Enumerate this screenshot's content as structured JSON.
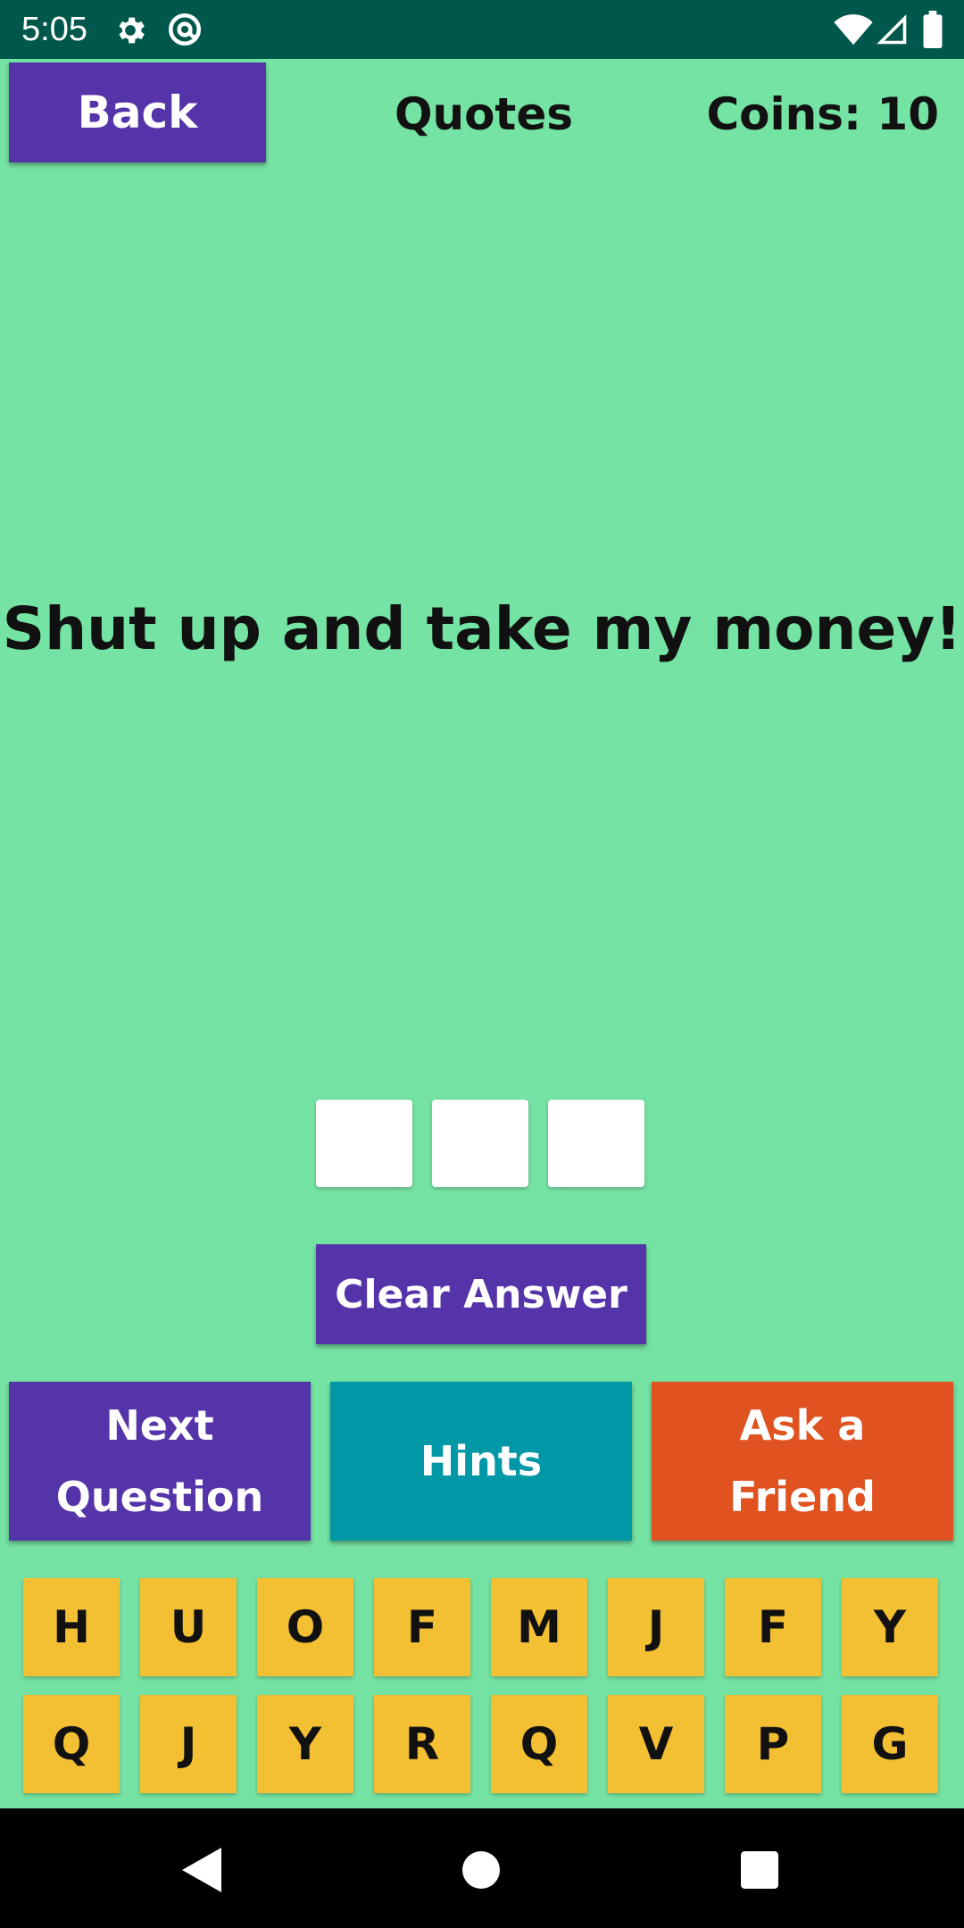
{
  "status_bar": {
    "time": "5:05",
    "icons": [
      "gear-icon",
      "at-sign-icon",
      "wifi-icon",
      "signal-icon",
      "battery-icon"
    ]
  },
  "header": {
    "back_label": "Back",
    "title": "Quotes",
    "coins": "Coins: 10"
  },
  "quote": "Shut up and take my money!",
  "answer_slots": [
    "",
    "",
    ""
  ],
  "clear_label": "Clear Answer",
  "actions": {
    "next_label": "Next\nQuestion",
    "hints_label": "Hints",
    "ask_label": "Ask a\nFriend"
  },
  "keys": {
    "row1": [
      "H",
      "U",
      "O",
      "F",
      "M",
      "J",
      "F",
      "Y"
    ],
    "row2": [
      "Q",
      "J",
      "Y",
      "R",
      "Q",
      "V",
      "P",
      "G"
    ]
  },
  "nav": {
    "icons": [
      "back-triangle-icon",
      "home-circle-icon",
      "recent-apps-square-icon"
    ]
  },
  "colors": {
    "background": "#75E3A3",
    "status_bar": "#00574B",
    "primary": "#5533A9",
    "hints": "#0097A7",
    "ask_friend": "#E05220",
    "key": "#F4C033"
  }
}
